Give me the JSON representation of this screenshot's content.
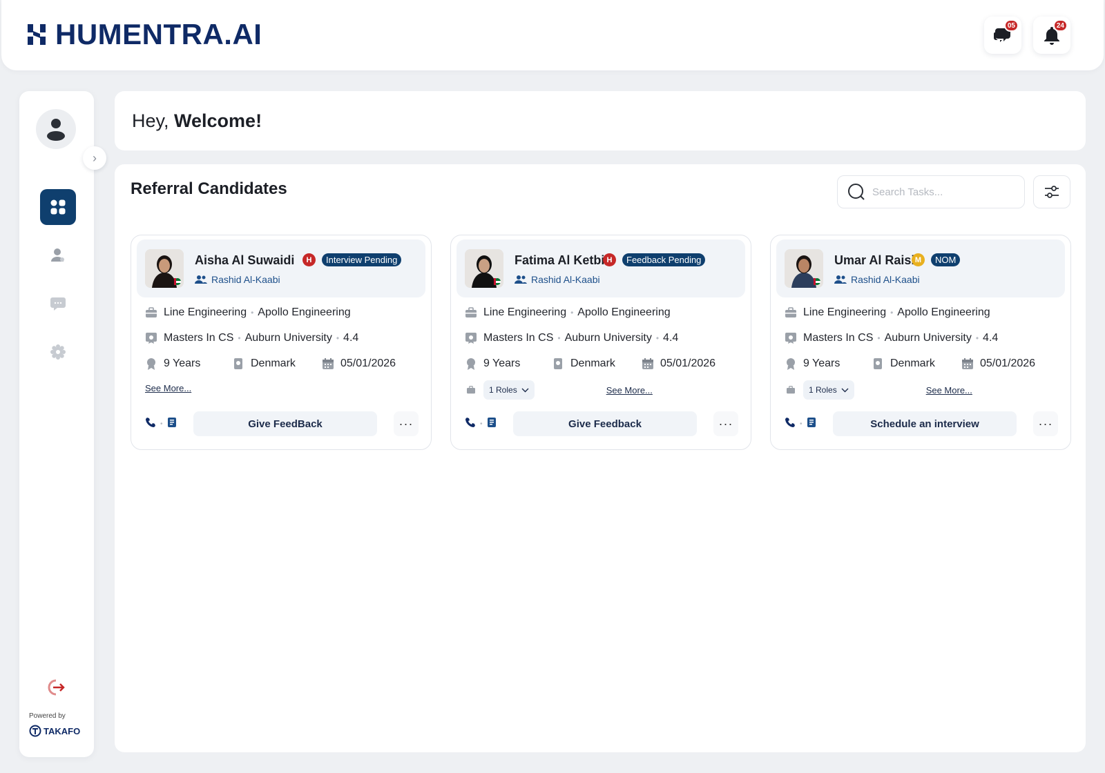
{
  "header": {
    "brand": "HUMENTRA.AI",
    "messages_count": "05",
    "notifications_count": "24"
  },
  "sidebar": {
    "powered_by": "Powered by",
    "partner": "TAKAFO",
    "items": [
      "dashboard",
      "candidates",
      "messages",
      "settings"
    ]
  },
  "welcome": {
    "greeting": "Hey,",
    "emphasis": "Welcome!"
  },
  "panel": {
    "title": "Referral Candidates",
    "search_placeholder": "Search Tasks..."
  },
  "colors": {
    "brand": "#0f2a66",
    "accent": "#0f3f6e",
    "priority_high": "#c62828",
    "priority_medium": "#e8b020"
  },
  "candidates": [
    {
      "name": "Aisha Al Suwaidi",
      "priority": "H",
      "status": "Interview Pending",
      "referrer": "Rashid Al-Kaabi",
      "department": "Line Engineering",
      "company": "Apollo Engineering",
      "degree": "Masters In CS",
      "university": "Auburn University",
      "gpa": "4.4",
      "experience": "9 Years",
      "country": "Denmark",
      "date": "05/01/2026",
      "roles": "",
      "see_more": "See More...",
      "action": "Give FeedBack"
    },
    {
      "name": "Fatima Al Ketbi",
      "priority": "H",
      "status": "Feedback Pending",
      "referrer": "Rashid Al-Kaabi",
      "department": "Line Engineering",
      "company": "Apollo Engineering",
      "degree": "Masters In CS",
      "university": "Auburn University",
      "gpa": "4.4",
      "experience": "9 Years",
      "country": "Denmark",
      "date": "05/01/2026",
      "roles": "1 Roles",
      "see_more": "See More...",
      "action": "Give Feedback"
    },
    {
      "name": "Umar Al Raisi",
      "priority": "M",
      "status": "NOM",
      "referrer": "Rashid Al-Kaabi",
      "department": "Line Engineering",
      "company": "Apollo Engineering",
      "degree": "Masters In CS",
      "university": "Auburn University",
      "gpa": "4.4",
      "experience": "9 Years",
      "country": "Denmark",
      "date": "05/01/2026",
      "roles": "1 Roles",
      "see_more": "See More...",
      "action": "Schedule an interview"
    }
  ]
}
